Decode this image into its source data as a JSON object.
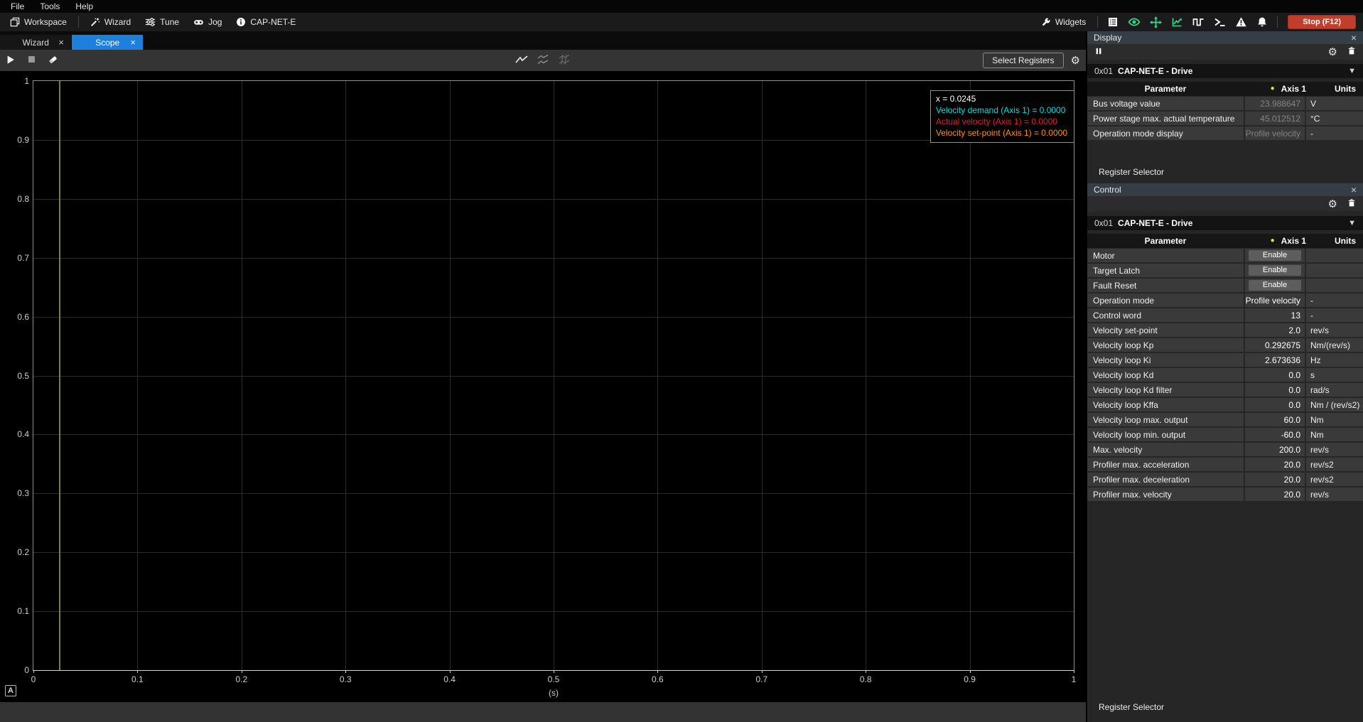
{
  "menu": {
    "items": [
      "File",
      "Tools",
      "Help"
    ]
  },
  "toolbar": {
    "workspace": "Workspace",
    "wizard": "Wizard",
    "tune": "Tune",
    "jog": "Jog",
    "device": "CAP-NET-E",
    "widgets": "Widgets",
    "stop": "Stop (F12)",
    "right_icons": [
      "register-list-icon",
      "monitor-eye-icon",
      "motion-move-icon",
      "scope-chart-icon",
      "signal-wave-icon",
      "console-icon",
      "warning-icon",
      "notification-bell-icon"
    ]
  },
  "tabs": [
    {
      "label": "Wizard",
      "active": false
    },
    {
      "label": "Scope",
      "active": true
    }
  ],
  "scope_toolbar": {
    "select_registers": "Select Registers",
    "icons": [
      "play-icon",
      "stop-capture-icon",
      "clear-plot-icon",
      "single-curve-icon",
      "multi-curve-icon",
      "split-curve-icon",
      "gear-icon"
    ]
  },
  "chart_data": {
    "type": "line",
    "title": "",
    "xlabel": "(s)",
    "ylabel": "",
    "xlim": [
      0,
      1
    ],
    "ylim": [
      0,
      1
    ],
    "grid": true,
    "x_ticks": [
      "0",
      "0.1",
      "0.2",
      "0.3",
      "0.4",
      "0.5",
      "0.6",
      "0.7",
      "0.8",
      "0.9",
      "1"
    ],
    "y_ticks": [
      "0",
      "0.1",
      "0.2",
      "0.3",
      "0.4",
      "0.5",
      "0.6",
      "0.7",
      "0.8",
      "0.9",
      "1"
    ],
    "cursor_x": 0.0245,
    "autoscale_label": "A",
    "tooltip_x_line": "x = 0.0245",
    "series": [
      {
        "name": "Velocity demand (Axis 1)",
        "color": "#00dfdf",
        "cursor_value": "0.0000"
      },
      {
        "name": "Actual velocity (Axis 1)",
        "color": "#df2020",
        "cursor_value": "0.0000"
      },
      {
        "name": "Velocity set-point (Axis 1)",
        "color": "#ff8c1a",
        "cursor_value": "0.0000"
      }
    ]
  },
  "panels": {
    "display": {
      "title": "Display",
      "device_id": "0x01",
      "device_name": "CAP-NET-E - Drive",
      "columns": {
        "parameter": "Parameter",
        "axis": "Axis 1",
        "units": "Units"
      },
      "rows": [
        {
          "label": "Bus voltage value",
          "value": "23.988647",
          "unit": "V",
          "dim": true
        },
        {
          "label": "Power stage max. actual temperature",
          "value": "45.012512",
          "unit": "°C",
          "dim": true
        },
        {
          "label": "Operation mode display",
          "value": "Profile velocity",
          "unit": "-",
          "dim": true
        }
      ],
      "register_selector": "Register Selector"
    },
    "control": {
      "title": "Control",
      "device_id": "0x01",
      "device_name": "CAP-NET-E - Drive",
      "columns": {
        "parameter": "Parameter",
        "axis": "Axis 1",
        "units": "Units"
      },
      "rows": [
        {
          "label": "Motor",
          "button": "Enable"
        },
        {
          "label": "Target Latch",
          "button": "Enable"
        },
        {
          "label": "Fault Reset",
          "button": "Enable"
        },
        {
          "label": "Operation mode",
          "value": "Profile velocity",
          "unit": "-"
        },
        {
          "label": "Control word",
          "value": "13",
          "unit": "-"
        },
        {
          "label": "Velocity set-point",
          "value": "2.0",
          "unit": "rev/s"
        },
        {
          "label": "Velocity loop Kp",
          "value": "0.292675",
          "unit": "Nm/(rev/s)"
        },
        {
          "label": "Velocity loop Ki",
          "value": "2.673636",
          "unit": "Hz"
        },
        {
          "label": "Velocity loop Kd",
          "value": "0.0",
          "unit": "s"
        },
        {
          "label": "Velocity loop Kd filter",
          "value": "0.0",
          "unit": "rad/s"
        },
        {
          "label": "Velocity loop Kffa",
          "value": "0.0",
          "unit": "Nm / (rev/s2)"
        },
        {
          "label": "Velocity loop max. output",
          "value": "60.0",
          "unit": "Nm"
        },
        {
          "label": "Velocity loop min. output",
          "value": "-60.0",
          "unit": "Nm"
        },
        {
          "label": "Max. velocity",
          "value": "200.0",
          "unit": "rev/s"
        },
        {
          "label": "Profiler max. acceleration",
          "value": "20.0",
          "unit": "rev/s2"
        },
        {
          "label": "Profiler max. deceleration",
          "value": "20.0",
          "unit": "rev/s2"
        },
        {
          "label": "Profiler max. velocity",
          "value": "20.0",
          "unit": "rev/s"
        }
      ],
      "register_selector": "Register Selector"
    }
  },
  "colors": {
    "accent_blue": "#1d80dd",
    "accent_green": "#35d98a",
    "stop_red": "#c13e2d",
    "cursor_yellow": "#7b7b40",
    "axis_dot_yellow": "#f2e22e",
    "series_cyan": "#00dfdf",
    "series_red": "#df2020",
    "series_orange": "#ff8c1a"
  }
}
